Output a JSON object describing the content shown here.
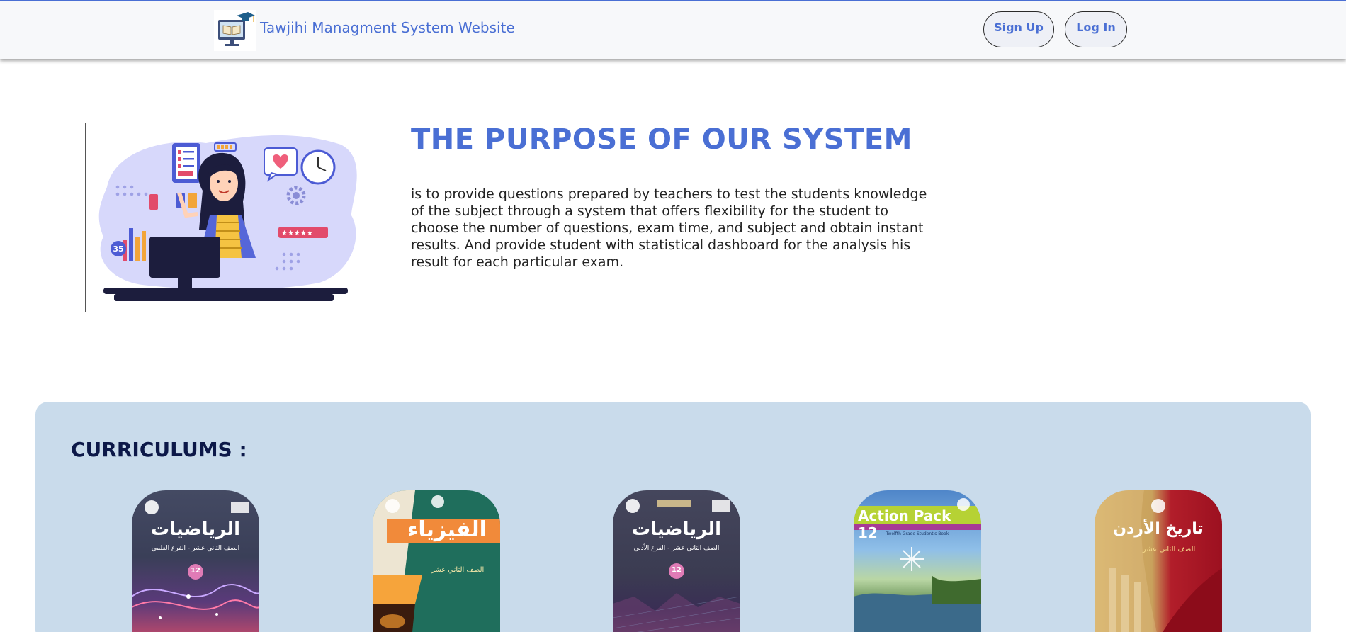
{
  "header": {
    "brand_title": "Tawjihi Managment System Website",
    "signup_label": "Sign Up",
    "login_label": "Log In"
  },
  "purpose": {
    "title": "THE PURPOSE OF OUR SYSTEM",
    "text": "is to provide questions prepared by teachers to test the students knowledge of the subject through a system that offers flexibility for the student to choose the number of questions, exam time, and subject and obtain instant results. And provide student with statistical dashboard for the analysis his result for each particular exam.",
    "illustration": {
      "chart_number": "35",
      "icons": [
        "checklist-icon",
        "heart-icon",
        "clock-icon",
        "gear-icon",
        "battery-icon",
        "graduation-cap-icon",
        "bar-chart-icon",
        "computer-monitor-icon",
        "rating-stars-icon"
      ]
    }
  },
  "curriculums": {
    "title": "CURRICULUMS :",
    "books": [
      {
        "title": "الرياضيات",
        "subtitle": "الصف الثاني عشر - الفرع العلمي",
        "grade": "12"
      },
      {
        "title": "الفيزياء",
        "subtitle": "الصف الثاني عشر",
        "grade": ""
      },
      {
        "title": "الرياضيات",
        "subtitle": "الصف الثاني عشر - الفرع الأدبي",
        "grade": "12"
      },
      {
        "title": "Action Pack 12",
        "subtitle": "Twelfth Grade Student's Book",
        "grade": "12"
      },
      {
        "title": "تاريخ الأردن",
        "subtitle": "الصف الثاني عشر",
        "grade": ""
      }
    ]
  },
  "colors": {
    "brand_blue": "#4a6fd4",
    "panel_blue": "#c9dbeb",
    "curriculum_title": "#0c1848"
  }
}
